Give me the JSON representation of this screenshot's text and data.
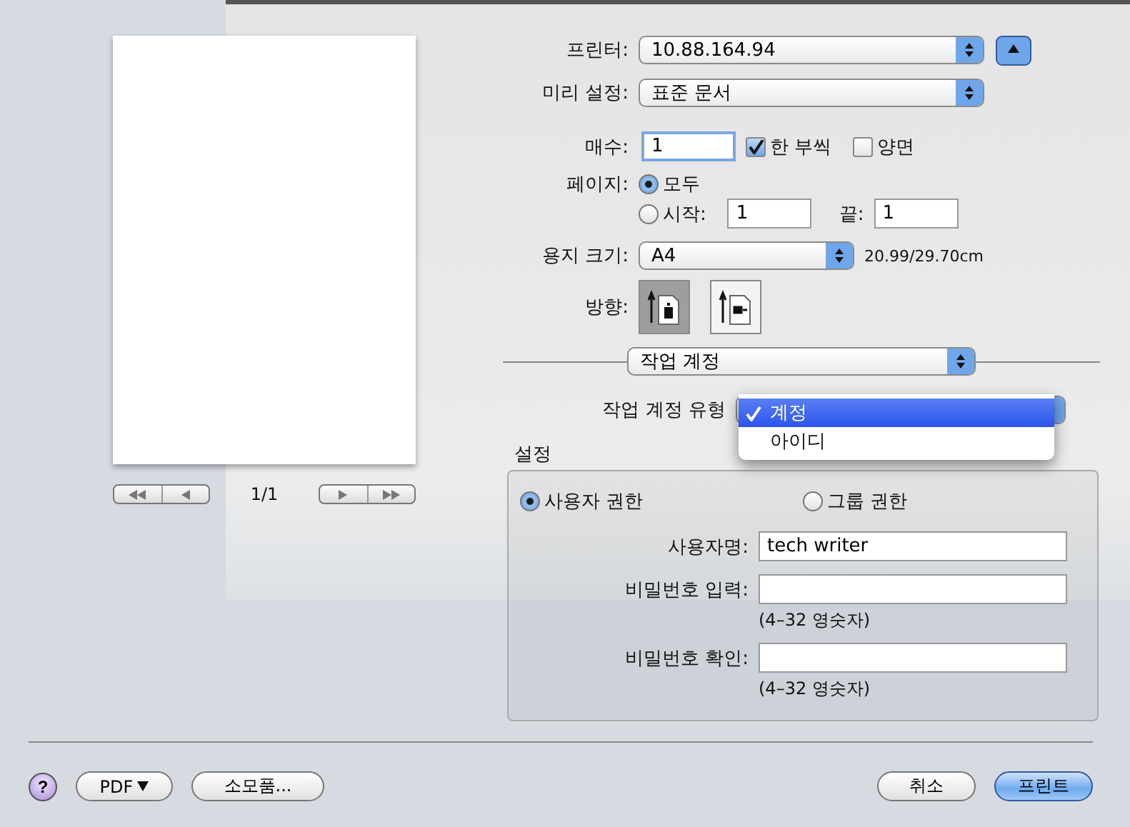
{
  "preview": {
    "page_indicator": "1/1"
  },
  "printer": {
    "label": "프린터:",
    "value": "10.88.164.94"
  },
  "presets": {
    "label": "미리 설정:",
    "value": "표준 문서"
  },
  "copies": {
    "label": "매수:",
    "value": "1",
    "options": [
      {
        "label": "한 부씩",
        "checked": true
      },
      {
        "label": "양면",
        "checked": false
      }
    ]
  },
  "pages": {
    "label": "페이지:",
    "options": [
      {
        "kind": "all",
        "label": "모두",
        "selected": true
      },
      {
        "kind": "range",
        "label": "시작:",
        "selected": false,
        "from": "1",
        "to_label": "끝:",
        "to": "1"
      }
    ]
  },
  "paper_size": {
    "label": "용지 크기:",
    "value": "A4",
    "dimensions": "20.99/29.70cm"
  },
  "orientation": {
    "label": "방향:",
    "options": [
      {
        "kind": "portrait",
        "selected": true
      },
      {
        "kind": "landscape",
        "selected": false
      }
    ]
  },
  "panel_menu": {
    "value": "작업 계정"
  },
  "job_accounting_type": {
    "label": "작업 계정 유형",
    "menu": [
      {
        "label": "계정",
        "selected": true
      },
      {
        "label": "아이디",
        "selected": false
      }
    ]
  },
  "settings": {
    "title": "설정",
    "permissions": [
      {
        "label": "사용자 권한",
        "selected": true
      },
      {
        "label": "그룹 권한",
        "selected": false
      }
    ],
    "fields": [
      {
        "label": "사용자명:",
        "value": "tech writer"
      },
      {
        "label": "비밀번호 입력:",
        "hint": "(4–32 영숫자)"
      },
      {
        "label": "비밀번호 확인:",
        "hint": "(4–32 영숫자)"
      }
    ]
  },
  "footer": {
    "help": "?",
    "pdf": "PDF",
    "supplies": "소모품...",
    "cancel": "취소",
    "print": "프린트"
  }
}
